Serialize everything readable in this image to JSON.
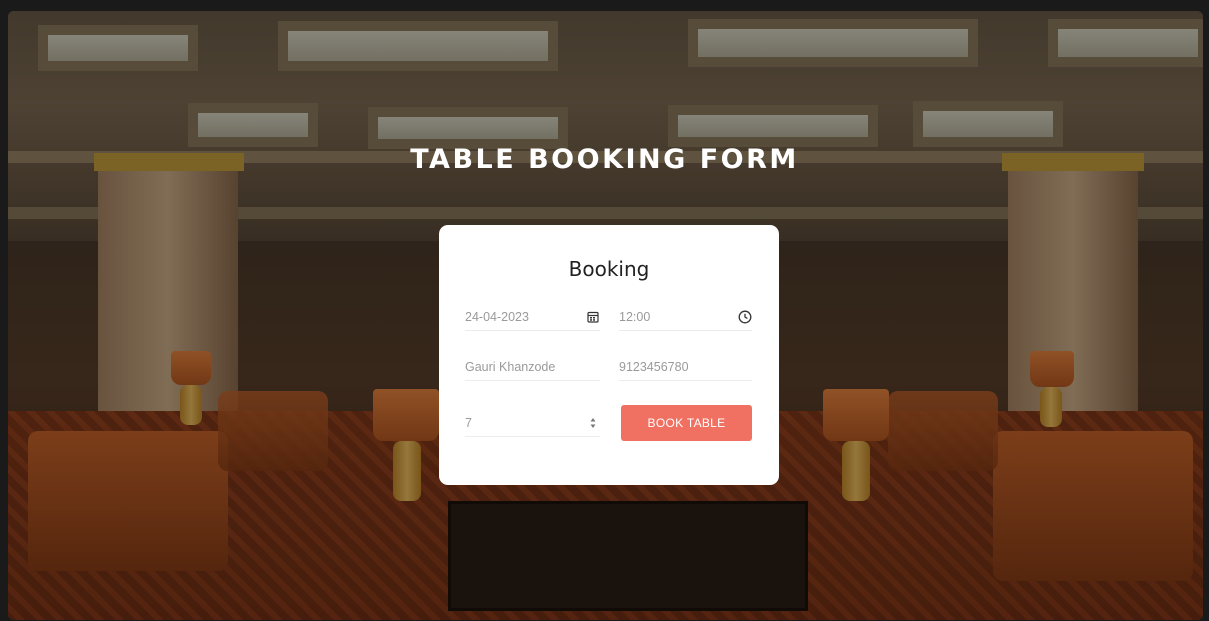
{
  "page": {
    "title": "TABLE BOOKING FORM"
  },
  "form": {
    "heading": "Booking",
    "date_value": "24-04-2023",
    "time_value": "12:00",
    "name_value": "Gauri Khanzode",
    "phone_value": "9123456780",
    "guests_value": "7",
    "submit_label": "BOOK TABLE"
  },
  "icons": {
    "date": "calendar-icon",
    "time": "clock-icon",
    "guests": "spinner-arrows-icon"
  },
  "colors": {
    "accent": "#f07062",
    "card_bg": "#ffffff",
    "title_text": "#ffffff"
  }
}
